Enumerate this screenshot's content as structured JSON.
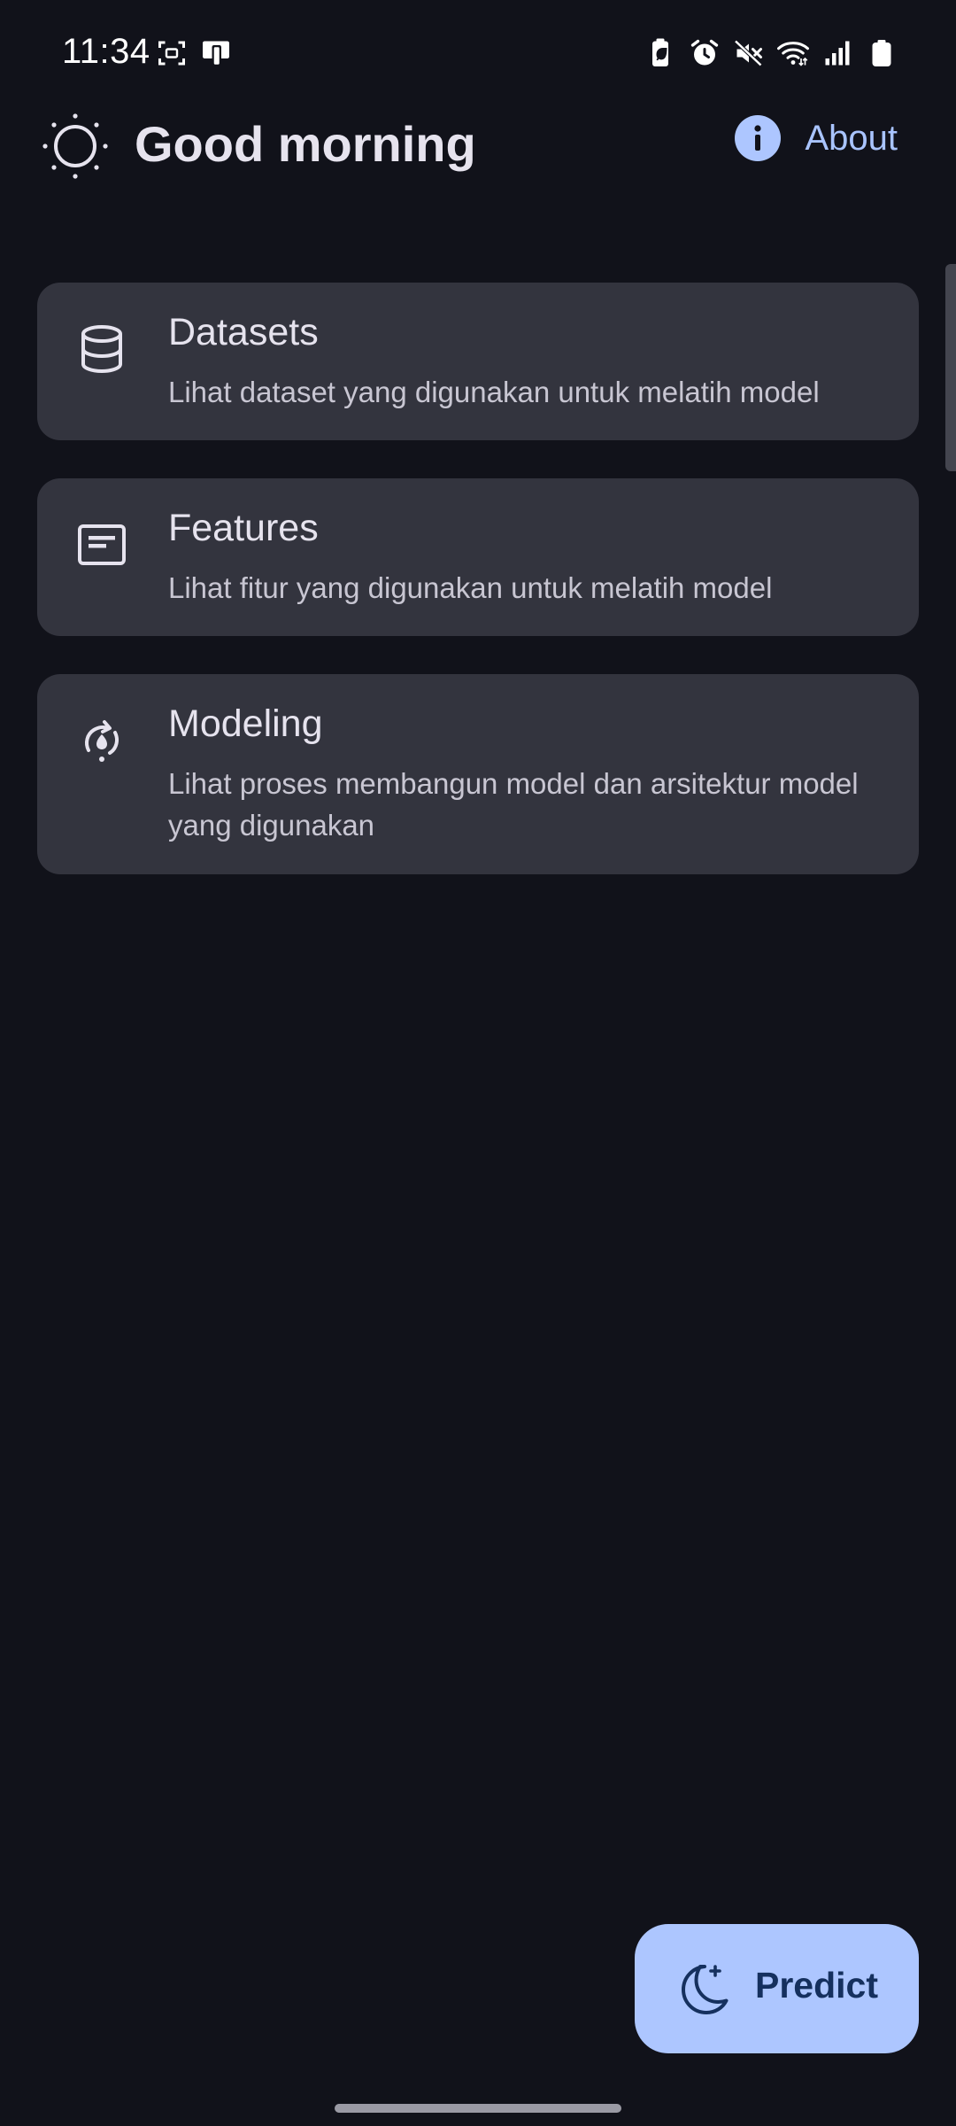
{
  "status_bar": {
    "time": "11:34",
    "left_icons": [
      "screenshot-icon",
      "device-icon"
    ],
    "right_icons": [
      "battery-saver-icon",
      "alarm-icon",
      "mute-icon",
      "wifi-icon",
      "signal-icon",
      "battery-icon"
    ]
  },
  "header": {
    "greeting": "Good morning",
    "greeting_icon": "sun-icon",
    "about_label": "About",
    "about_icon": "info-icon"
  },
  "cards": [
    {
      "icon": "database-icon",
      "title": "Datasets",
      "description": "Lihat dataset yang digunakan untuk melatih model"
    },
    {
      "icon": "feature-card-icon",
      "title": "Features",
      "description": "Lihat fitur yang digunakan untuk melatih model"
    },
    {
      "icon": "modeling-cycle-icon",
      "title": "Modeling",
      "description": "Lihat proses membangun model dan arsitektur model yang digunakan"
    }
  ],
  "fab": {
    "label": "Predict",
    "icon": "moon-icon"
  },
  "colors": {
    "background": "#11121a",
    "card": "#33343e",
    "accent": "#adc6ff",
    "about_text": "#a9c4ff"
  }
}
